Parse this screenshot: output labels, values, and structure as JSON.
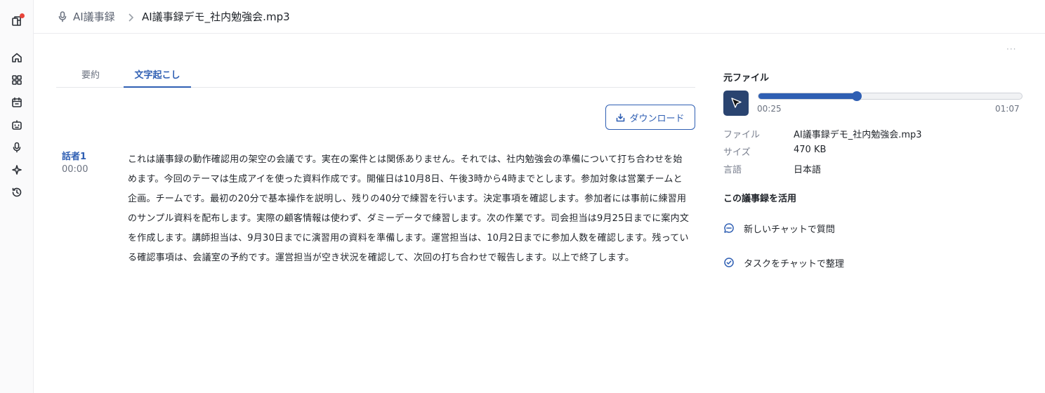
{
  "breadcrumb": {
    "parent": "AI議事録",
    "current": "AI議事録デモ_社内勉強会.mp3"
  },
  "more_menu": "···",
  "tabs": [
    {
      "label": "要約",
      "active": false
    },
    {
      "label": "文字起こし",
      "active": true
    }
  ],
  "download_label": "ダウンロード",
  "transcript": {
    "speaker": "話者1",
    "time": "00:00",
    "text": "これは議事録の動作確認用の架空の会議です。実在の案件とは関係ありません。それでは、社内勉強会の準備について打ち合わせを始めます。今回のテーマは生成アイを使った資料作成です。開催日は10月8日、午後3時から4時までとします。参加対象は営業チームと企画。チームです。最初の20分で基本操作を説明し、残りの40分で練習を行います。決定事項を確認します。参加者には事前に練習用のサンプル資料を配布します。実際の顧客情報は使わず、ダミーデータで練習します。次の作業です。司会担当は9月25日までに案内文を作成します。講師担当は、9月30日までに演習用の資料を準備します。運営担当は、10月2日までに参加人数を確認します。残っている確認事項は、会議室の予約です。運営担当が空き状況を確認して、次回の打ち合わせで報告します。以上で終了します。"
  },
  "right_panel": {
    "title": "元ファイル",
    "player": {
      "current": "00:25",
      "total": "01:07",
      "progress": 0.373
    },
    "meta": [
      {
        "label": "ファイル",
        "value": "AI議事録デモ_社内勉強会.mp3"
      },
      {
        "label": "サイズ",
        "value": "470 KB"
      },
      {
        "label": "言語",
        "value": "日本語"
      }
    ],
    "use_title": "この議事録を活用",
    "actions": [
      {
        "label": "新しいチャットで質問",
        "icon": "chat-icon"
      },
      {
        "label": "タスクをチャットで整理",
        "icon": "check-circle-icon"
      }
    ]
  },
  "colors": {
    "accent": "#2f5fb3",
    "notification": "#e8443a",
    "player_button": "#2a4470"
  }
}
